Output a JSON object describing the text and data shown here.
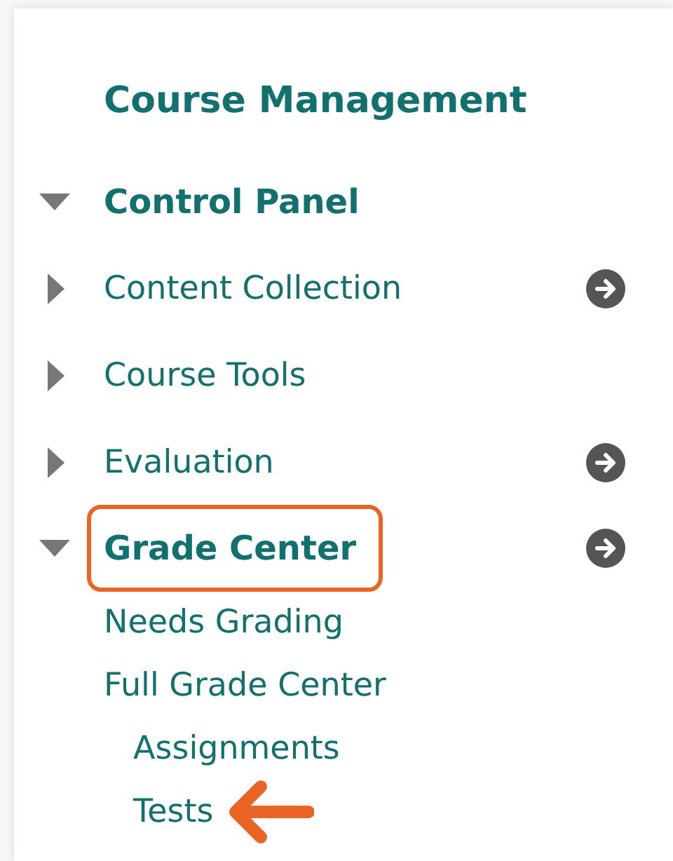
{
  "heading": "Course Management",
  "tree": [
    {
      "label": "Control Panel",
      "expanded": true,
      "menu_button": false,
      "highlighted": false,
      "children": [
        {
          "label": "Content Collection",
          "expanded": false,
          "menu_button": true,
          "highlighted": false
        },
        {
          "label": "Course Tools",
          "expanded": false,
          "menu_button": false,
          "highlighted": false
        },
        {
          "label": "Evaluation",
          "expanded": false,
          "menu_button": true,
          "highlighted": false
        },
        {
          "label": "Grade Center",
          "expanded": true,
          "menu_button": true,
          "highlighted": true,
          "children": [
            {
              "label": "Needs Grading",
              "pointed": false
            },
            {
              "label": "Full Grade Center",
              "pointed": false,
              "children": [
                {
                  "label": "Assignments",
                  "pointed": false
                },
                {
                  "label": "Tests",
                  "pointed": true
                }
              ]
            }
          ]
        }
      ]
    }
  ]
}
